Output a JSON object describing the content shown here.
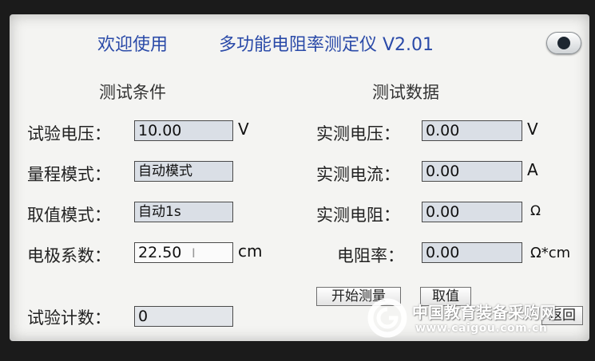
{
  "header": {
    "welcome": "欢迎使用",
    "title": "多功能电阻率测定仪 V2.01"
  },
  "conditions": {
    "section_title": "测试条件",
    "voltage_label": "试验电压：",
    "voltage_value": "10.00",
    "voltage_unit": "V",
    "range_label": "量程模式：",
    "range_value": "自动模式",
    "sampling_label": "取值模式：",
    "sampling_value": "自动1s",
    "electrode_label": "电极系数：",
    "electrode_value": "22.50",
    "electrode_unit": "cm",
    "count_label": "试验计数：",
    "count_value": "0"
  },
  "data": {
    "section_title": "测试数据",
    "measured_voltage_label": "实测电压：",
    "measured_voltage_value": "0.00",
    "measured_voltage_unit": "V",
    "measured_current_label": "实测电流：",
    "measured_current_value": "0.00",
    "measured_current_unit": "A",
    "measured_resistance_label": "实测电阻：",
    "measured_resistance_value": "0.00",
    "measured_resistance_unit": "Ω",
    "resistivity_label": "电阻率：",
    "resistivity_value": "0.00",
    "resistivity_unit": "Ω*cm"
  },
  "buttons": {
    "start_label": "开始测量",
    "sample_label": "取值",
    "back_label": "返回"
  },
  "watermark": {
    "brand": "中国教育装备采购网",
    "url": "www.caigou.com.cn"
  },
  "colors": {
    "title_blue": "#2a4aa8",
    "field_fill": "#dadfe6",
    "screen_bg": "#f4f4f2"
  }
}
